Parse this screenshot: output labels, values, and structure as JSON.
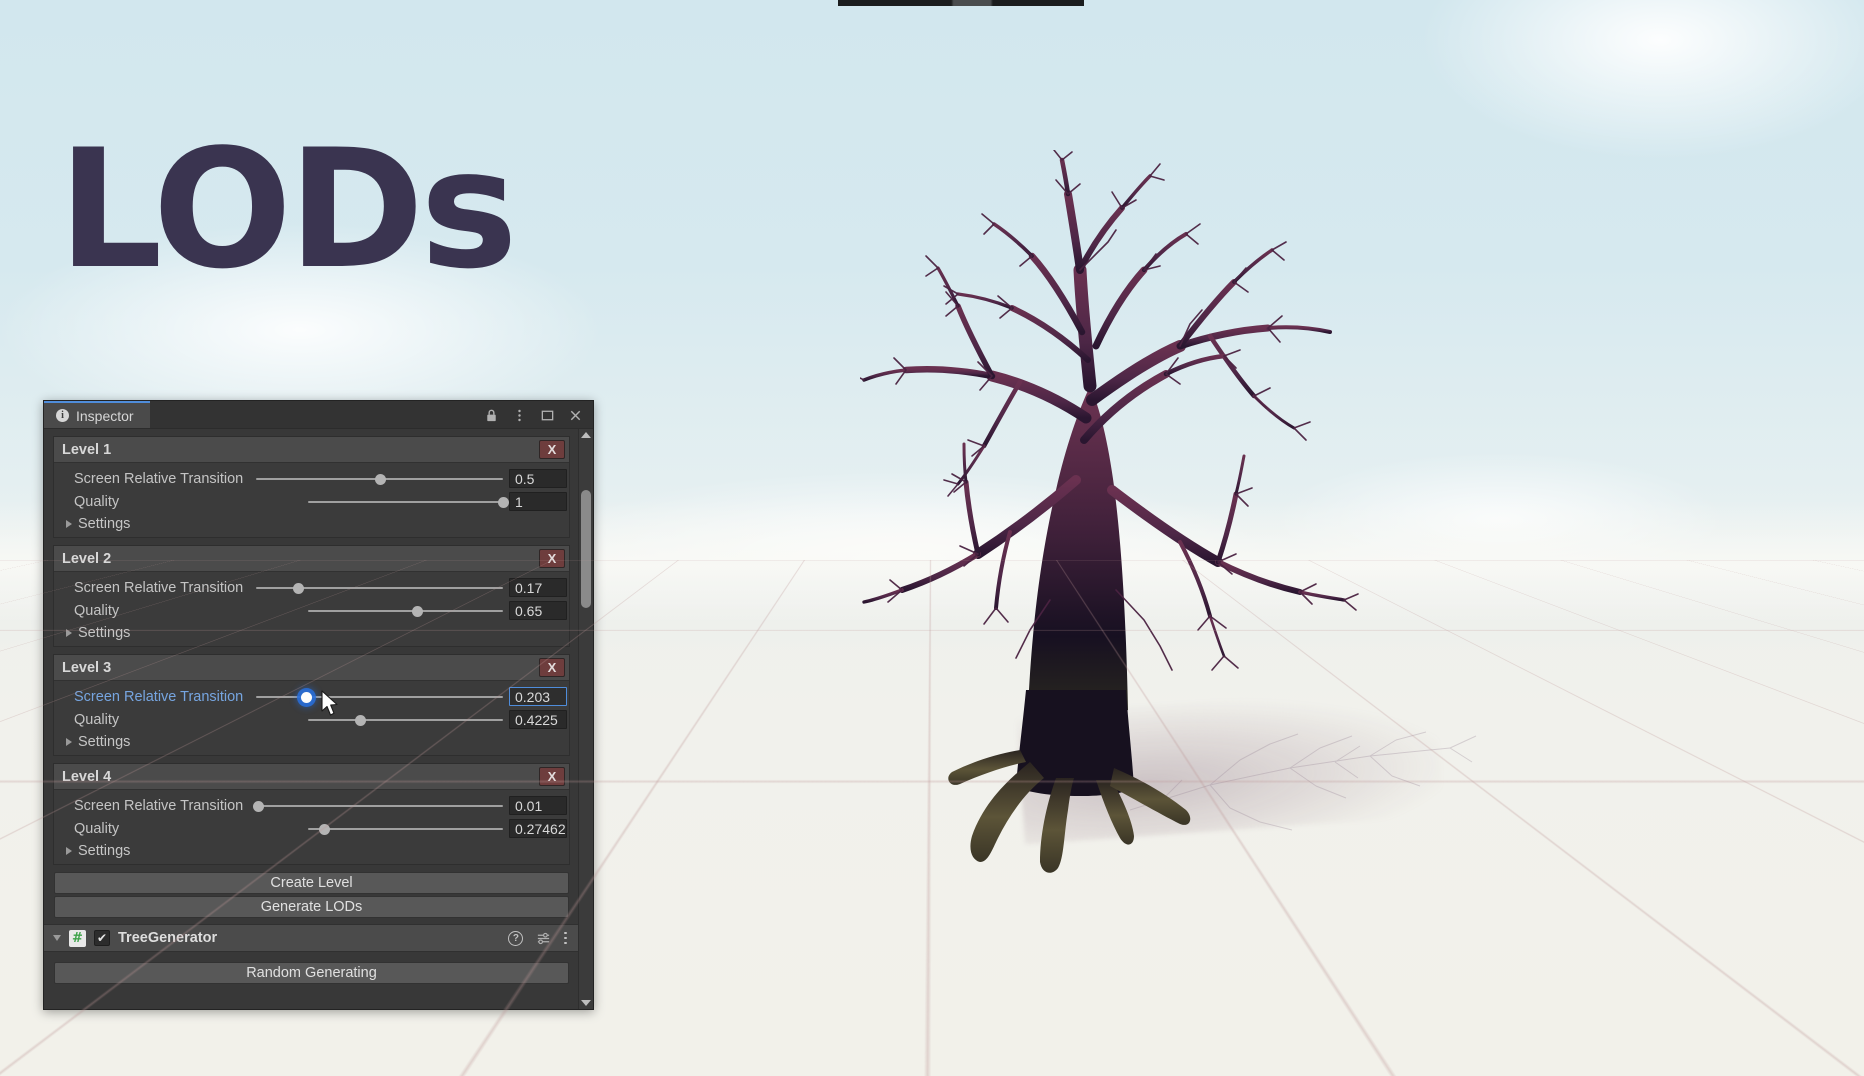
{
  "scene": {
    "overlay_title": "LODs",
    "overlay_title_color": "#3a3450",
    "sky_color": "#d6e9ef",
    "ground_color": "#f1f1ec",
    "tree_color": "#6b3350"
  },
  "inspector": {
    "tab_label": "Inspector",
    "tab_icon": "info-circle-icon",
    "accent_color": "#4f8ddb",
    "titlebar_icons": [
      "lock-icon",
      "kebab-menu-icon",
      "maximize-icon",
      "close-icon"
    ],
    "levels": [
      {
        "title": "Level 1",
        "remove_label": "X",
        "rows": [
          {
            "label": "Screen Relative Transition",
            "value": "0.5",
            "fill": 0.5,
            "active": false
          },
          {
            "label": "Quality",
            "value": "1",
            "fill": 1.0,
            "active": false
          }
        ],
        "settings_label": "Settings"
      },
      {
        "title": "Level 2",
        "remove_label": "X",
        "rows": [
          {
            "label": "Screen Relative Transition",
            "value": "0.17",
            "fill": 0.17,
            "active": false
          },
          {
            "label": "Quality",
            "value": "0.65",
            "fill": 0.65,
            "active": false
          }
        ],
        "settings_label": "Settings"
      },
      {
        "title": "Level 3",
        "remove_label": "X",
        "rows": [
          {
            "label": "Screen Relative Transition",
            "value": "0.203",
            "fill": 0.203,
            "active": true
          },
          {
            "label": "Quality",
            "value": "0.4225",
            "fill": 0.4225,
            "active": false
          }
        ],
        "settings_label": "Settings"
      },
      {
        "title": "Level 4",
        "remove_label": "X",
        "rows": [
          {
            "label": "Screen Relative Transition",
            "value": "0.01",
            "fill": 0.01,
            "active": false
          },
          {
            "label": "Quality",
            "value": "0.27462",
            "fill": 0.27462,
            "active": false
          }
        ],
        "settings_label": "Settings"
      }
    ],
    "buttons": {
      "create_level": "Create Level",
      "generate_lods": "Generate LODs"
    },
    "component": {
      "name": "TreeGenerator",
      "enabled": true,
      "checkbox_glyph": "✔",
      "script_icon_glyph": "#",
      "icons": [
        "help-icon",
        "preset-icon",
        "kebab-menu-icon"
      ],
      "button_label": "Random Generating"
    },
    "scrollbar": {
      "up_arrow": "▲",
      "down_arrow": "▼"
    }
  }
}
